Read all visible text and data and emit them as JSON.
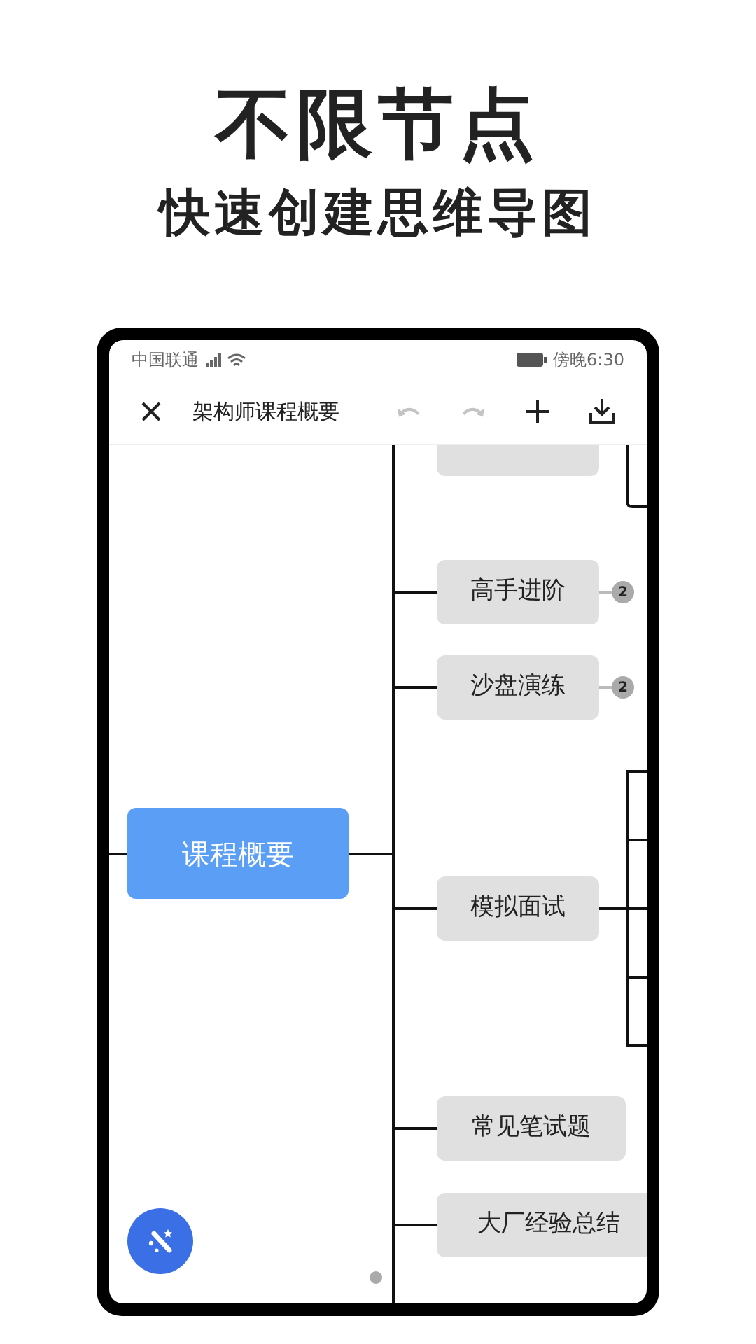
{
  "headline": "不限节点",
  "subheadline": "快速创建思维导图",
  "status_bar": {
    "carrier": "中国联通",
    "time": "傍晚6:30"
  },
  "toolbar": {
    "title": "架构师课程概要",
    "actions": [
      {
        "kind": "undo",
        "disabled": true
      },
      {
        "kind": "redo",
        "disabled": true
      },
      {
        "kind": "add",
        "disabled": false
      },
      {
        "kind": "download",
        "disabled": false
      }
    ]
  },
  "mind_map": {
    "root": "课程概要",
    "branches": [
      {
        "label": "高手进阶",
        "badge": "2"
      },
      {
        "label": "沙盘演练",
        "badge": "2"
      },
      {
        "label": "模拟面试"
      },
      {
        "label": "常见笔试题"
      },
      {
        "label": "大厂经验总结"
      }
    ]
  }
}
